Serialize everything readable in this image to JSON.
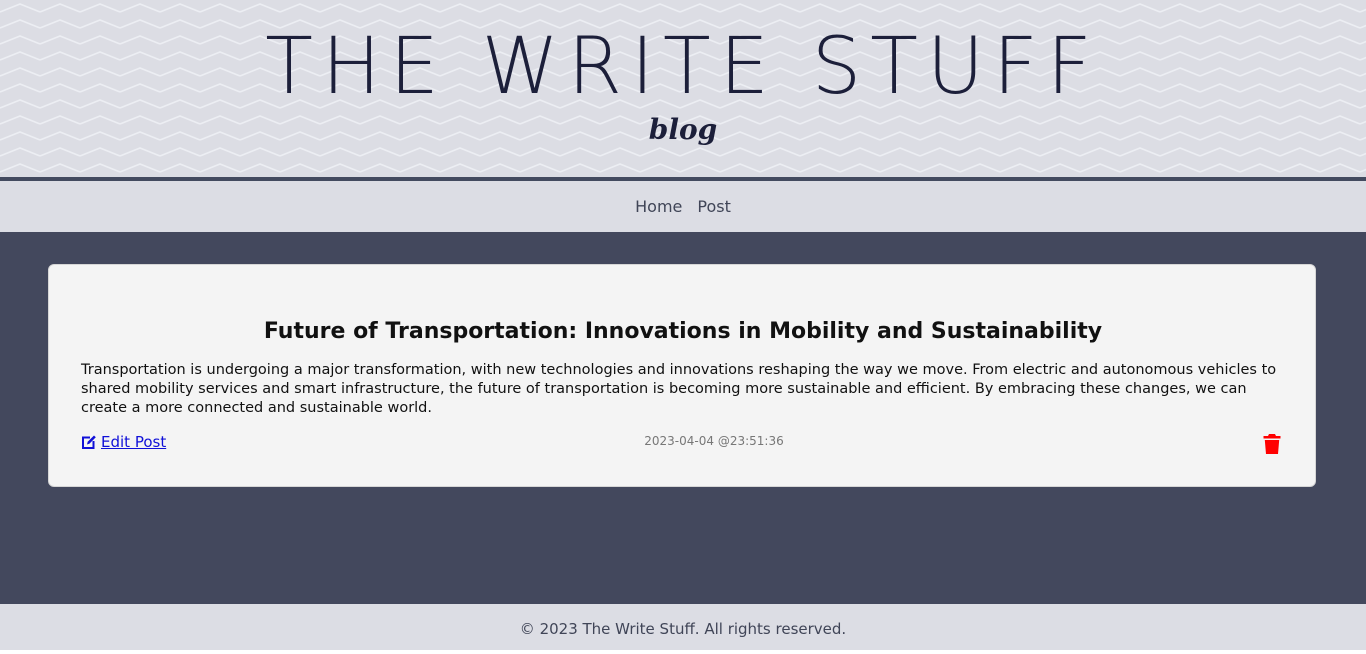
{
  "header": {
    "title": "THE WRITE STUFF",
    "subtitle": "blog"
  },
  "nav": {
    "items": [
      {
        "label": "Home"
      },
      {
        "label": "Post"
      }
    ]
  },
  "post": {
    "title": "Future of Transportation: Innovations in Mobility and Sustainability",
    "body": "Transportation is undergoing a major transformation, with new technologies and innovations reshaping the way we move. From electric and autonomous vehicles to shared mobility services and smart infrastructure, the future of transportation is becoming more sustainable and efficient. By embracing these changes, we can create a more connected and sustainable world.",
    "edit_label": " Edit Post",
    "edit_icon": "edit-icon",
    "timestamp": "2023-04-04 @23:51:36",
    "delete_icon": "trash-icon"
  },
  "footer": {
    "text": "© 2023 The Write Stuff. All rights reserved."
  },
  "colors": {
    "header_bg": "#dcdde4",
    "main_bg": "#43485d",
    "card_bg": "#f4f4f4",
    "link": "#1010d8",
    "delete": "#ff0000"
  }
}
